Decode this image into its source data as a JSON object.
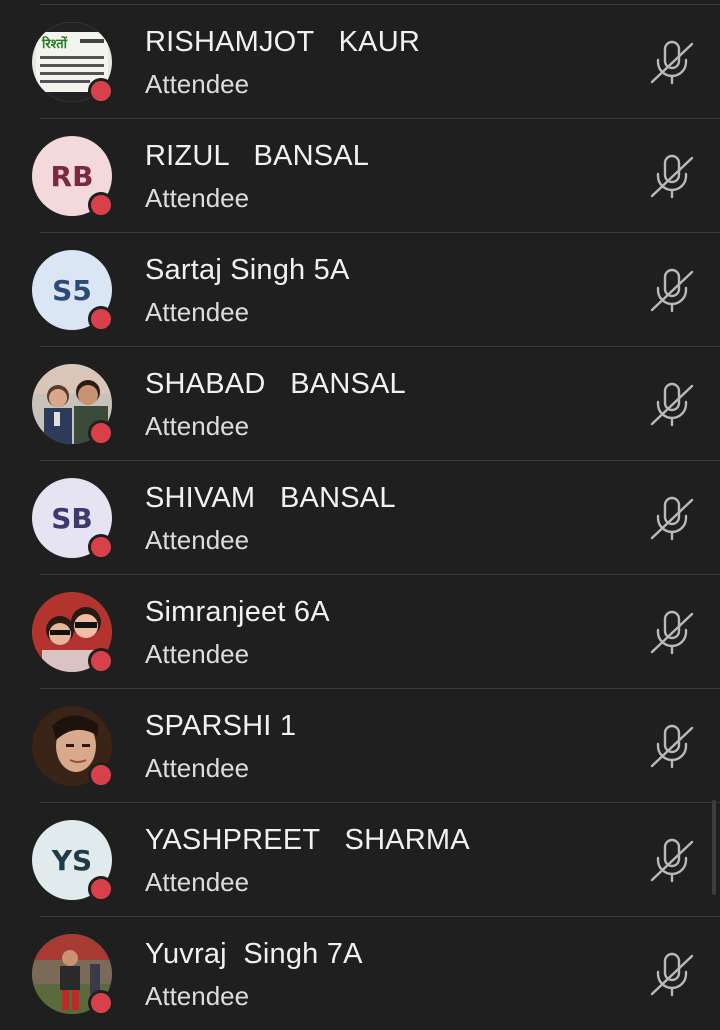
{
  "colors": {
    "background": "#1f1f1f",
    "presence_busy": "#d9414a",
    "name_text": "#f1f1f1",
    "role_text": "#dcdcdc",
    "divider": "#3a3a3a",
    "icon": "#b9b9b9"
  },
  "participants": [
    {
      "name": "RISHAMJOT   KAUR",
      "role": "Attendee",
      "avatar": {
        "type": "photo",
        "description": "poster-photo"
      },
      "presence": "busy",
      "mic": "mic-off-icon"
    },
    {
      "name": "RIZUL   BANSAL",
      "role": "Attendee",
      "avatar": {
        "type": "initials",
        "initials": "RB",
        "bg": "#f3d9dc",
        "fg": "#7a2a3a"
      },
      "presence": "busy",
      "mic": "mic-off-icon"
    },
    {
      "name": "Sartaj Singh 5A",
      "role": "Attendee",
      "avatar": {
        "type": "initials",
        "initials": "S5",
        "bg": "#dbe6f5",
        "fg": "#2b4a78"
      },
      "presence": "busy",
      "mic": "mic-off-icon"
    },
    {
      "name": "SHABAD   BANSAL",
      "role": "Attendee",
      "avatar": {
        "type": "photo",
        "description": "two-people-photo"
      },
      "presence": "busy",
      "mic": "mic-off-icon"
    },
    {
      "name": "SHIVAM   BANSAL",
      "role": "Attendee",
      "avatar": {
        "type": "initials",
        "initials": "SB",
        "bg": "#e6e4f2",
        "fg": "#3e3a6e"
      },
      "presence": "busy",
      "mic": "mic-off-icon"
    },
    {
      "name": "Simranjeet 6A",
      "role": "Attendee",
      "avatar": {
        "type": "photo",
        "description": "two-women-selfie-photo"
      },
      "presence": "busy",
      "mic": "mic-off-icon"
    },
    {
      "name": "SPARSHI 1",
      "role": "Attendee",
      "avatar": {
        "type": "photo",
        "description": "woman-portrait-photo"
      },
      "presence": "busy",
      "mic": "mic-off-icon"
    },
    {
      "name": "YASHPREET   SHARMA",
      "role": "Attendee",
      "avatar": {
        "type": "initials",
        "initials": "YS",
        "bg": "#e1ebee",
        "fg": "#1f3c46"
      },
      "presence": "busy",
      "mic": "mic-off-icon"
    },
    {
      "name": "Yuvraj  Singh 7A",
      "role": "Attendee",
      "avatar": {
        "type": "photo",
        "description": "boy-photo"
      },
      "presence": "busy",
      "mic": "mic-off-icon"
    }
  ]
}
